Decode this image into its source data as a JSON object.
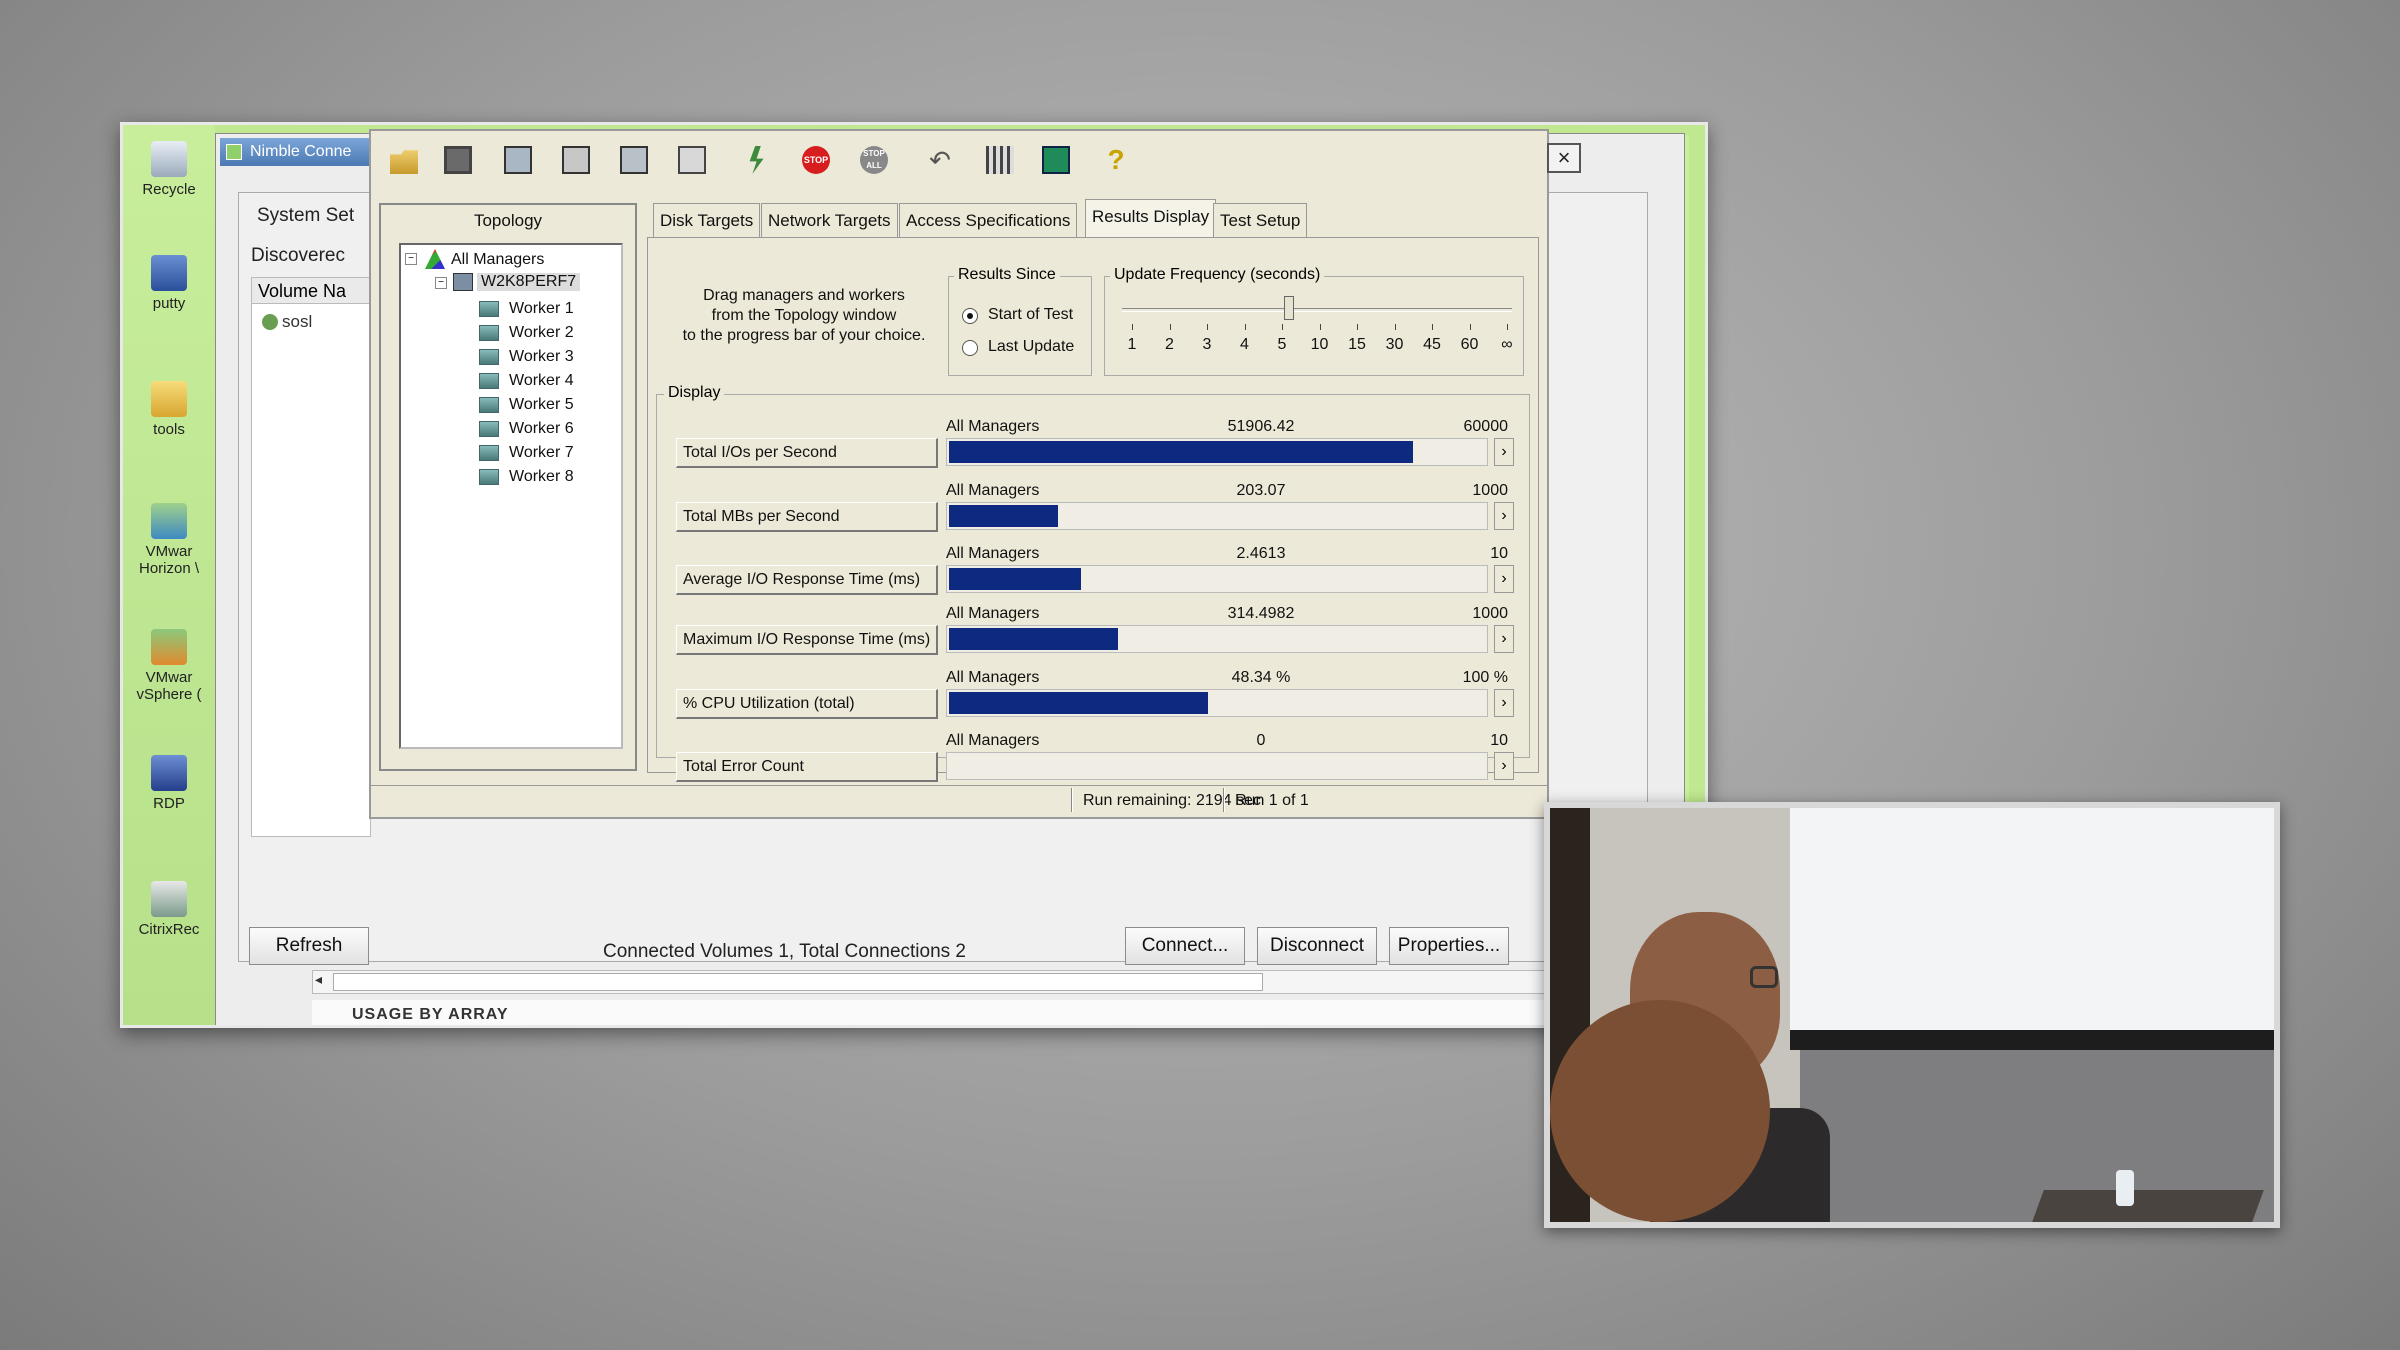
{
  "desktop": {
    "icons": [
      {
        "label": "Recycle",
        "icon": "recycle-bin-icon"
      },
      {
        "label": "putty",
        "icon": "putty-icon"
      },
      {
        "label": "tools",
        "icon": "folder-icon"
      },
      {
        "label": "VMwar\nHorizon \\",
        "label1": "VMwar",
        "label2": "Horizon \\",
        "icon": "vmware-horizon-icon"
      },
      {
        "label1": "VMwar",
        "label2": "vSphere (",
        "icon": "vmware-vsphere-icon"
      },
      {
        "label": "RDP",
        "icon": "rdp-icon"
      },
      {
        "label": "CitrixRec",
        "icon": "citrix-icon"
      }
    ]
  },
  "nimble": {
    "title": "Nimble Conne",
    "system_settings": "System Set",
    "discovered": "Discoverec",
    "volume_header": "Volume Na",
    "volume_row": "sosl",
    "refresh": "Refresh",
    "status": "Connected Volumes 1, Total Connections 2",
    "connect": "Connect...",
    "disconnect": "Disconnect",
    "properties": "Properties...",
    "usage_label": "USAGE BY ARRAY"
  },
  "iometer": {
    "toolbar": [
      "open-icon",
      "save-icon",
      "new-manager-icon",
      "new-disk-worker-icon",
      "new-network-worker-icon",
      "copy-worker-icon",
      "start-icon",
      "stop-icon",
      "stop-all-icon",
      "reset-icon",
      "exit-icon",
      "help-icon"
    ],
    "close": "×",
    "topology": {
      "title": "Topology",
      "all_managers": "All Managers",
      "manager": "W2K8PERF7",
      "workers": [
        "Worker 1",
        "Worker 2",
        "Worker 3",
        "Worker 4",
        "Worker 5",
        "Worker 6",
        "Worker 7",
        "Worker 8"
      ]
    },
    "tabs": [
      "Disk Targets",
      "Network Targets",
      "Access Specifications",
      "Results Display",
      "Test Setup"
    ],
    "active_tab": "Results Display",
    "drag_hint_1": "Drag managers and workers",
    "drag_hint_2": "from the Topology window",
    "drag_hint_3": "to the progress bar of your choice.",
    "results_since": {
      "label": "Results Since",
      "options": [
        "Start of Test",
        "Last Update"
      ],
      "selected": "Start of Test"
    },
    "update_frequency": {
      "label": "Update Frequency (seconds)",
      "ticks": [
        "1",
        "2",
        "3",
        "4",
        "5",
        "10",
        "15",
        "30",
        "45",
        "60",
        "∞"
      ],
      "selected": "5"
    },
    "display_label": "Display",
    "metrics": [
      {
        "label": "Total I/Os per Second",
        "scope": "All Managers",
        "value": "51906.42",
        "max": "60000",
        "fill": 0.865
      },
      {
        "label": "Total MBs per Second",
        "scope": "All Managers",
        "value": "203.07",
        "max": "1000",
        "fill": 0.2031
      },
      {
        "label": "Average I/O Response Time (ms)",
        "scope": "All Managers",
        "value": "2.4613",
        "max": "10",
        "fill": 0.2461
      },
      {
        "label": "Maximum I/O Response Time (ms)",
        "scope": "All Managers",
        "value": "314.4982",
        "max": "1000",
        "fill": 0.3145
      },
      {
        "label": "% CPU Utilization (total)",
        "scope": "All Managers",
        "value": "48.34 %",
        "max": "100 %",
        "fill": 0.4834
      },
      {
        "label": "Total Error Count",
        "scope": "All Managers",
        "value": "0",
        "max": "10",
        "fill": 0
      }
    ],
    "run_remaining": "Run remaining: 2194 sec",
    "run_of": "Run 1 of 1"
  },
  "colors": {
    "bar": "#0d2a80",
    "desktop_bg": "#bfe890",
    "window_bg": "#ece9d8"
  }
}
